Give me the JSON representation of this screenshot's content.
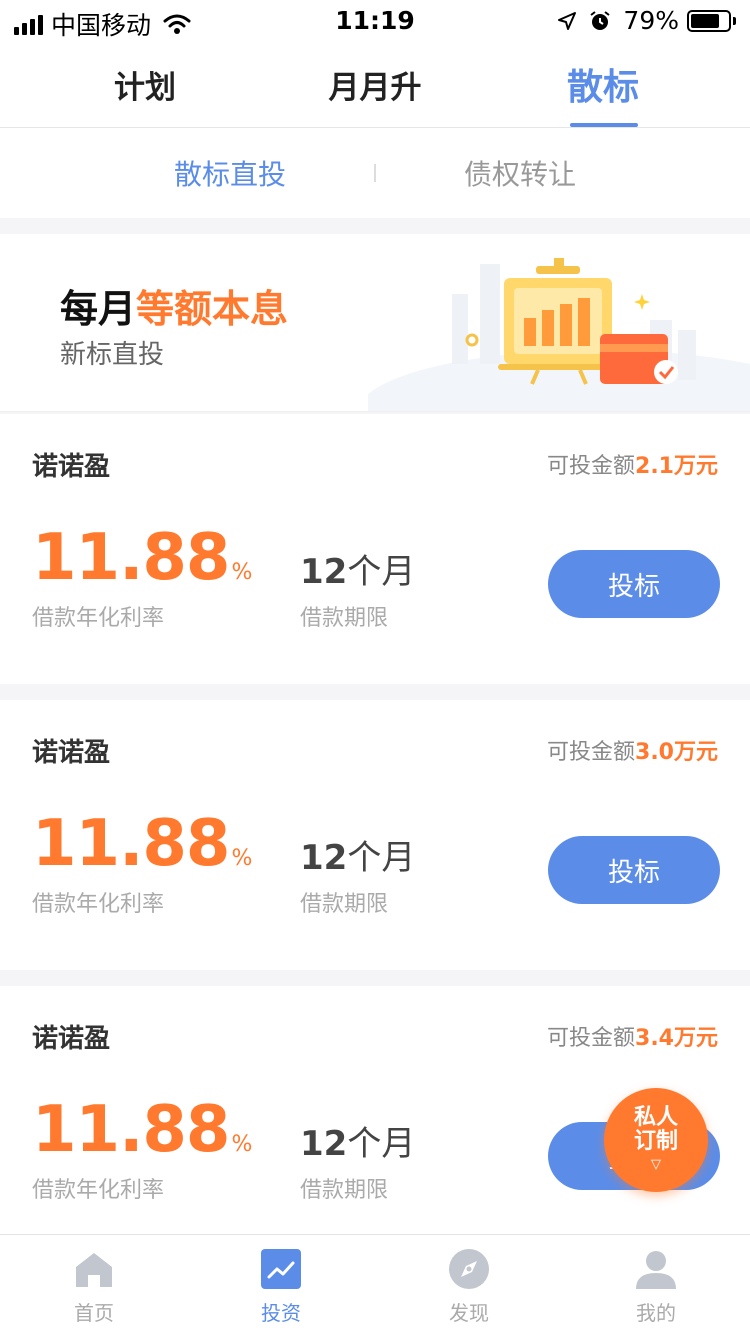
{
  "status_bar": {
    "carrier": "中国移动",
    "time": "11:19",
    "battery_percent": "79%",
    "battery_level": 0.79
  },
  "top_tabs": [
    {
      "label": "计划",
      "active": false
    },
    {
      "label": "月月升",
      "active": false
    },
    {
      "label": "散标",
      "active": true
    }
  ],
  "sub_tabs": [
    {
      "label": "散标直投",
      "active": true
    },
    {
      "label": "债权转让",
      "active": false
    }
  ],
  "banner": {
    "title_prefix": "每月",
    "title_highlight": "等额本息",
    "subtitle": "新标直投"
  },
  "products": [
    {
      "name": "诺诺盈",
      "available_label": "可投金额",
      "available_amount": "2.1万元",
      "rate": "11.88",
      "rate_unit": "%",
      "rate_label": "借款年化利率",
      "term_value": "12",
      "term_unit": "个月",
      "term_label": "借款期限",
      "button_label": "投标"
    },
    {
      "name": "诺诺盈",
      "available_label": "可投金额",
      "available_amount": "3.0万元",
      "rate": "11.88",
      "rate_unit": "%",
      "rate_label": "借款年化利率",
      "term_value": "12",
      "term_unit": "个月",
      "term_label": "借款期限",
      "button_label": "投标"
    },
    {
      "name": "诺诺盈",
      "available_label": "可投金额",
      "available_amount": "3.4万元",
      "rate": "11.88",
      "rate_unit": "%",
      "rate_label": "借款年化利率",
      "term_value": "12",
      "term_unit": "个月",
      "term_label": "借款期限",
      "button_label": "投标"
    }
  ],
  "float_badge": {
    "line1": "私人",
    "line2": "订制",
    "arrow": "▽"
  },
  "bottom_nav": [
    {
      "label": "首页",
      "icon": "home-icon",
      "active": false
    },
    {
      "label": "投资",
      "icon": "invest-chart-icon",
      "active": true
    },
    {
      "label": "发现",
      "icon": "compass-icon",
      "active": false
    },
    {
      "label": "我的",
      "icon": "user-icon",
      "active": false
    }
  ],
  "colors": {
    "accent_blue": "#5b8de8",
    "accent_orange": "#ff7a2f",
    "inactive_gray": "#aaaaaa"
  }
}
